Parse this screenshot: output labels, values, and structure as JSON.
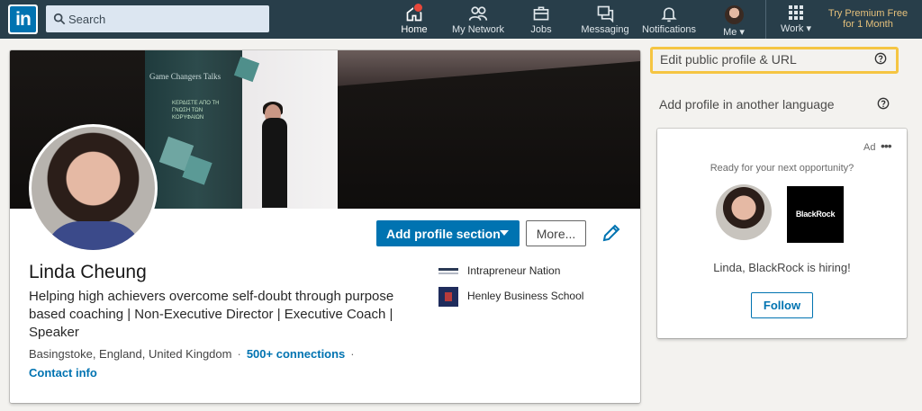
{
  "nav": {
    "logo_text": "in",
    "search_placeholder": "Search",
    "items": [
      {
        "label": "Home",
        "icon": "home-icon",
        "has_badge": true
      },
      {
        "label": "My Network",
        "icon": "network-icon"
      },
      {
        "label": "Jobs",
        "icon": "briefcase-icon"
      },
      {
        "label": "Messaging",
        "icon": "messaging-icon"
      },
      {
        "label": "Notifications",
        "icon": "bell-icon"
      },
      {
        "label": "Me",
        "icon": "avatar"
      },
      {
        "label": "Work",
        "icon": "grid-icon"
      }
    ],
    "premium_line1": "Try Premium Free",
    "premium_line2": "for 1 Month"
  },
  "banner": {
    "event_title": "Game Changers Talks",
    "greek_text": "ΚΕΡΔΙΣΤΕ ΑΠΟ ΤΗ ΓΝΩΣΗ ΤΩΝ ΚΟΡΥΦΑΙΩΝ"
  },
  "profile": {
    "name": "Linda Cheung",
    "headline": "Helping high achievers overcome self-doubt through purpose based coaching | Non-Executive Director | Executive Coach | Speaker",
    "location": "Basingstoke, England, United Kingdom",
    "separator": "·",
    "connections": "500+ connections",
    "contact_info": "Contact info",
    "add_section_label": "Add profile section",
    "more_label": "More...",
    "companies": [
      {
        "name": "Intrapreneur Nation"
      },
      {
        "name": "Henley Business School"
      }
    ]
  },
  "sidebar": {
    "edit_public_profile": "Edit public profile & URL",
    "add_language": "Add profile in another language"
  },
  "ad": {
    "label": "Ad",
    "menu": "•••",
    "tagline": "Ready for your next opportunity?",
    "brand": "BlackRock",
    "text": "Linda, BlackRock is hiring!",
    "follow_label": "Follow"
  },
  "colors": {
    "nav_bg": "#283e4a",
    "brand_blue": "#0073b1",
    "premium_gold": "#e5c07b",
    "highlight_yellow": "#f5c542",
    "page_bg": "#f3f2ef"
  }
}
